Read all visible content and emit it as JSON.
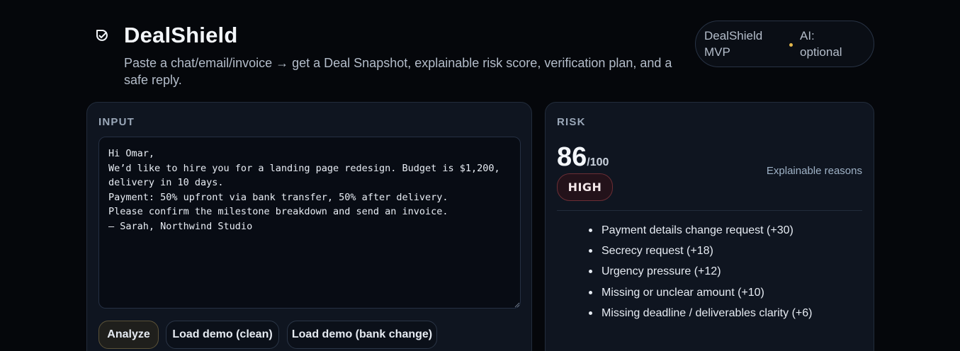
{
  "header": {
    "title": "DealShield",
    "subtitle": "Paste a chat/email/invoice → get a Deal Snapshot, explainable risk score, verification plan, and a safe reply."
  },
  "status_pill": {
    "product": "DealShield MVP",
    "ai_status": "AI: optional",
    "dot_color": "#e2b64b"
  },
  "input_panel": {
    "label": "INPUT",
    "text": "Hi Omar,\nWe’d like to hire you for a landing page redesign. Budget is $1,200,\ndelivery in 10 days.\nPayment: 50% upfront via bank transfer, 50% after delivery.\nPlease confirm the milestone breakdown and send an invoice.\n— Sarah, Northwind Studio",
    "buttons": {
      "analyze": "Analyze",
      "demo_clean": "Load demo (clean)",
      "demo_bank": "Load demo (bank change)"
    }
  },
  "risk_panel": {
    "label": "RISK",
    "score": "86",
    "score_max": "/100",
    "level": "HIGH",
    "reasons_label": "Explainable reasons",
    "reasons": [
      "Payment details change request (+30)",
      "Secrecy request (+18)",
      "Urgency pressure (+12)",
      "Missing or unclear amount (+10)",
      "Missing deadline / deliverables clarity (+6)"
    ]
  }
}
